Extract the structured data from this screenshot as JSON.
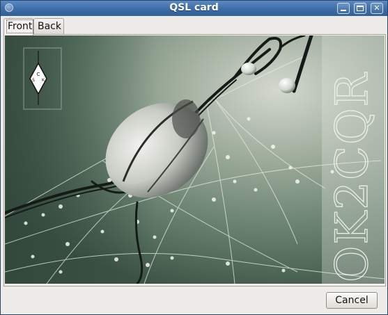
{
  "window": {
    "title": "QSL card"
  },
  "tabs": [
    {
      "label": "Front",
      "selected": true
    },
    {
      "label": "Back",
      "selected": false
    }
  ],
  "card": {
    "callsign": "OK2CQR",
    "logo_letters": [
      "C",
      "S",
      "K"
    ]
  },
  "buttons": {
    "cancel_label": "Cancel"
  }
}
